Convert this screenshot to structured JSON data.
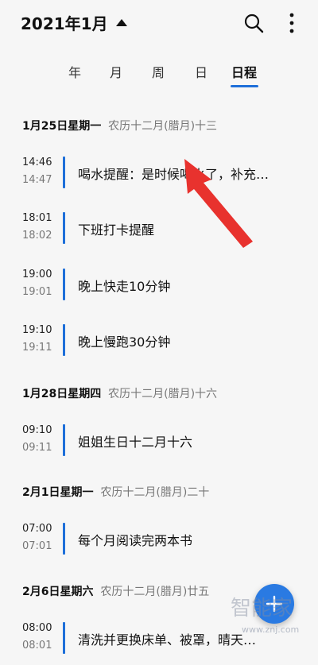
{
  "header": {
    "title": "2021年1月",
    "icons": [
      "caret-up-icon",
      "search-icon",
      "more-vertical-icon"
    ]
  },
  "tabs": [
    {
      "label": "年",
      "active": false
    },
    {
      "label": "月",
      "active": false
    },
    {
      "label": "周",
      "active": false
    },
    {
      "label": "日",
      "active": false
    },
    {
      "label": "日程",
      "active": true
    }
  ],
  "agenda": [
    {
      "date": "1月25日星期一",
      "lunar": "农历十二月(腊月)十三",
      "events": [
        {
          "start": "14:46",
          "end": "14:47",
          "title": "喝水提醒：是时候喝水了，补充…"
        },
        {
          "start": "18:01",
          "end": "18:02",
          "title": "下班打卡提醒"
        },
        {
          "start": "19:00",
          "end": "19:01",
          "title": "晚上快走10分钟"
        },
        {
          "start": "19:10",
          "end": "19:11",
          "title": "晚上慢跑30分钟"
        }
      ]
    },
    {
      "date": "1月28日星期四",
      "lunar": "农历十二月(腊月)十六",
      "events": [
        {
          "start": "09:10",
          "end": "09:11",
          "title": "姐姐生日十二月十六"
        }
      ]
    },
    {
      "date": "2月1日星期一",
      "lunar": "农历十二月(腊月)二十",
      "events": [
        {
          "start": "07:00",
          "end": "07:01",
          "title": "每个月阅读完两本书"
        }
      ]
    },
    {
      "date": "2月6日星期六",
      "lunar": "农历十二月(腊月)廿五",
      "events": [
        {
          "start": "08:00",
          "end": "08:01",
          "title": "清洗并更换床单、被罩，晴天…"
        }
      ]
    }
  ],
  "fab": {
    "icon": "plus-icon"
  },
  "watermark": {
    "text": "智能家",
    "url": "www.znj.com"
  },
  "colors": {
    "accent": "#1e6fd9",
    "annotation_arrow": "#e8322e",
    "background": "#f6f6f6"
  }
}
